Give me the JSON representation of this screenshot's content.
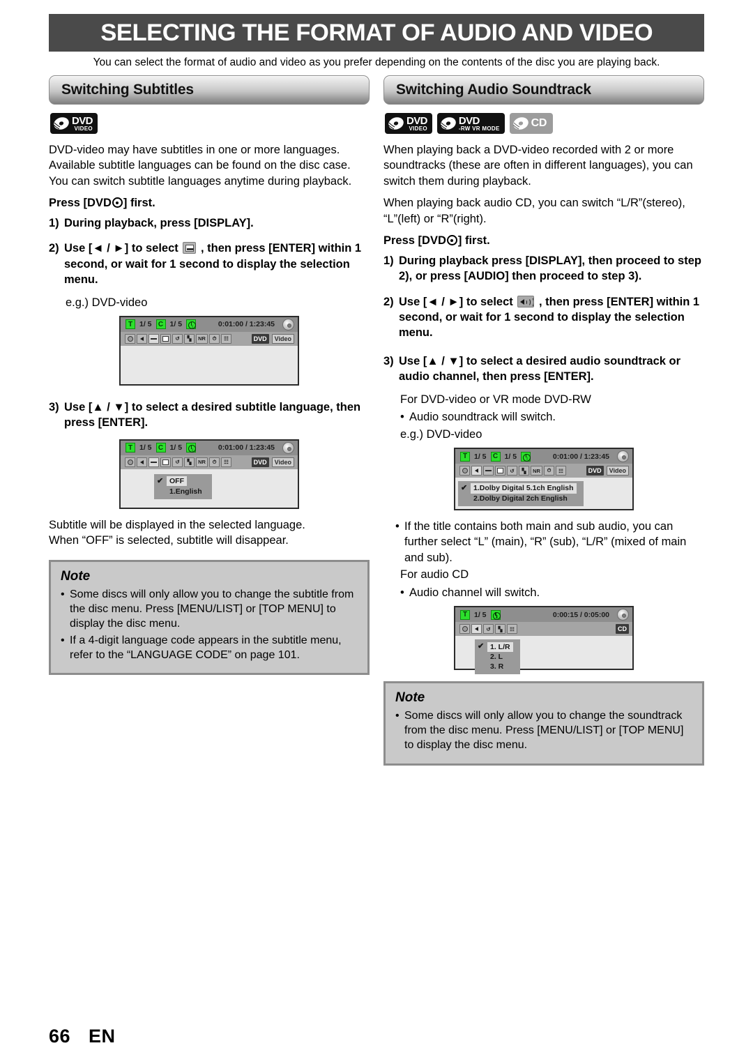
{
  "page": {
    "title": "SELECTING THE FORMAT OF AUDIO AND VIDEO",
    "intro": "You can select the format of audio and video as you prefer depending on the contents of the disc you are playing back.",
    "footer_number": "66",
    "footer_lang": "EN"
  },
  "left": {
    "heading": "Switching Subtitles",
    "badges": [
      {
        "name": "dvd-video-badge",
        "main": "DVD",
        "sub": "VIDEO",
        "style": "dark"
      }
    ],
    "paragraph": "DVD-video may have subtitles in one or more languages. Available subtitle languages can be found on the disc case. You can switch subtitle languages anytime during playback.",
    "press_first_pre": "Press [DVD",
    "press_first_post": "] first.",
    "steps": [
      {
        "num": "1)",
        "text": "During playback, press [DISPLAY]."
      },
      {
        "num": "2)",
        "pre": "Use [◄ / ►] to select",
        "icon": "subtitle-icon",
        "post": ", then press [ENTER] within 1 second, or wait for 1 second to display the selection menu."
      },
      {
        "num": "3)",
        "text": "Use [▲ / ▼] to select a desired subtitle language, then press [ENTER]."
      }
    ],
    "eg_label": "e.g.) DVD-video",
    "after_text_1": "Subtitle will be displayed in the selected language.",
    "after_text_2": "When “OFF” is selected, subtitle will disappear.",
    "note": {
      "title": "Note",
      "bullets": [
        "Some discs will only allow you to change the subtitle from the disc menu. Press [MENU/LIST] or [TOP MENU] to display the disc menu.",
        "If a 4-digit language code appears in the subtitle menu, refer to the “LANGUAGE CODE” on page 101."
      ]
    }
  },
  "right": {
    "heading": "Switching Audio Soundtrack",
    "badges": [
      {
        "name": "dvd-video-badge",
        "main": "DVD",
        "sub": "VIDEO",
        "style": "dark"
      },
      {
        "name": "dvd-rw-vr-mode-badge",
        "main": "DVD",
        "sub": "-RW VR MODE",
        "style": "dark"
      },
      {
        "name": "cd-badge",
        "main": "CD",
        "sub": "",
        "style": "grey"
      }
    ],
    "paragraph1": "When playing back a DVD-video recorded with 2 or more soundtracks (these are often in different languages), you can switch them during playback.",
    "paragraph2": "When playing back audio CD, you can switch “L/R”(stereo), “L”(left) or “R”(right).",
    "press_first_pre": "Press [DVD",
    "press_first_post": "] first.",
    "steps": [
      {
        "num": "1)",
        "text": "During playback press [DISPLAY], then proceed to step 2), or press [AUDIO] then proceed to step 3)."
      },
      {
        "num": "2)",
        "pre": "Use [◄ / ►] to select",
        "icon": "audio-icon",
        "post": ", then press [ENTER] within 1 second, or wait for 1 second to display the selection menu."
      },
      {
        "num": "3)",
        "text": "Use [▲ / ▼] to select a desired audio soundtrack or audio channel, then press [ENTER]."
      }
    ],
    "for_dvd_label": "For DVD-video or VR mode DVD-RW",
    "dvd_bullet": "Audio soundtrack will switch.",
    "eg_label": "e.g.) DVD-video",
    "mid_bullet": "If the title contains both main and sub audio, you can further select “L” (main), “R” (sub), “L/R” (mixed of main and sub).",
    "for_cd_label": "For audio CD",
    "cd_bullet": "Audio channel will switch.",
    "note": {
      "title": "Note",
      "bullets": [
        "Some discs will only allow you to change the soundtrack from the disc menu. Press [MENU/LIST] or [TOP MENU] to display the disc menu."
      ]
    }
  },
  "osd": {
    "dvd_status": {
      "title_icon": "T",
      "title_value": "1/ 5",
      "chapter_icon": "C",
      "chapter_value": "1/ 5",
      "time_value": "0:01:00 / 1:23:45",
      "tag_primary": "DVD",
      "tag_secondary": "Video",
      "mini_icons": [
        "search-icon",
        "audio-icon",
        "subtitle-icon",
        "angle-icon",
        "repeat-icon",
        "digest-icon",
        "noise-reduction-icon",
        "time-icon",
        "marker-icon"
      ],
      "nr_label": "NR"
    },
    "cd_status": {
      "title_icon": "T",
      "title_value": "1/ 5",
      "time_value": "0:00:15 / 0:05:00",
      "tag_primary": "CD",
      "mini_icons": [
        "search-icon",
        "audio-icon",
        "repeat-icon",
        "digest-icon",
        "marker-icon"
      ]
    },
    "subtitle_menu": {
      "items": [
        {
          "label": "OFF",
          "selected": true
        },
        {
          "label": "1.English",
          "selected": false
        }
      ]
    },
    "audio_menu": {
      "items": [
        {
          "label": "1.Dolby Digital  5.1ch English",
          "selected": true
        },
        {
          "label": "2.Dolby Digital    2ch English",
          "selected": false
        }
      ]
    },
    "channel_menu": {
      "items": [
        {
          "label": "1. L/R",
          "selected": true
        },
        {
          "label": "2. L",
          "selected": false
        },
        {
          "label": "3. R",
          "selected": false
        }
      ]
    },
    "check_glyph": "✔"
  }
}
